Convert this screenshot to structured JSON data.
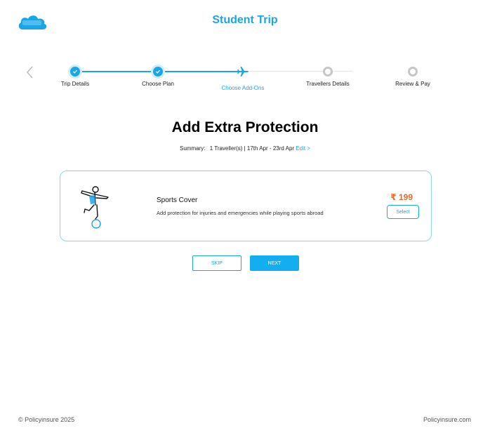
{
  "brand": {
    "logo_text": "Policyinsure",
    "accent_color": "#1aa6e6",
    "price_color": "#f26522"
  },
  "header": {
    "title": "Student Trip",
    "back_icon": "chevron-left-icon"
  },
  "stepper": {
    "steps": [
      {
        "label": "Trip Details",
        "status": "completed",
        "icon": "check-icon"
      },
      {
        "label": "Choose Plan",
        "status": "completed",
        "icon": "check-icon"
      },
      {
        "label": "Choose Add-Ons",
        "status": "current",
        "icon": "airplane-icon"
      },
      {
        "label": "Travellers Details",
        "status": "upcoming",
        "icon": "circle-icon"
      },
      {
        "label": "Review & Pay",
        "status": "upcoming",
        "icon": "circle-icon"
      }
    ]
  },
  "main": {
    "heading": "Add Extra Protection",
    "summary": {
      "label": "Summary:",
      "text": "1 Traveller(s) | 17th Apr - 23rd Apr",
      "edit": "Edit >"
    }
  },
  "addon": {
    "icon": "football-player-icon",
    "title": "Sports Cover",
    "description": "Add protection for injuries and emergencies while playing sports abroad",
    "price": "₹ 199",
    "select_label": "Select"
  },
  "actions": {
    "skip_label": "SKIP",
    "next_label": "NEXT"
  },
  "footer": {
    "copyright": "© Policyinsure 2025",
    "site": "Policyinsure.com"
  }
}
